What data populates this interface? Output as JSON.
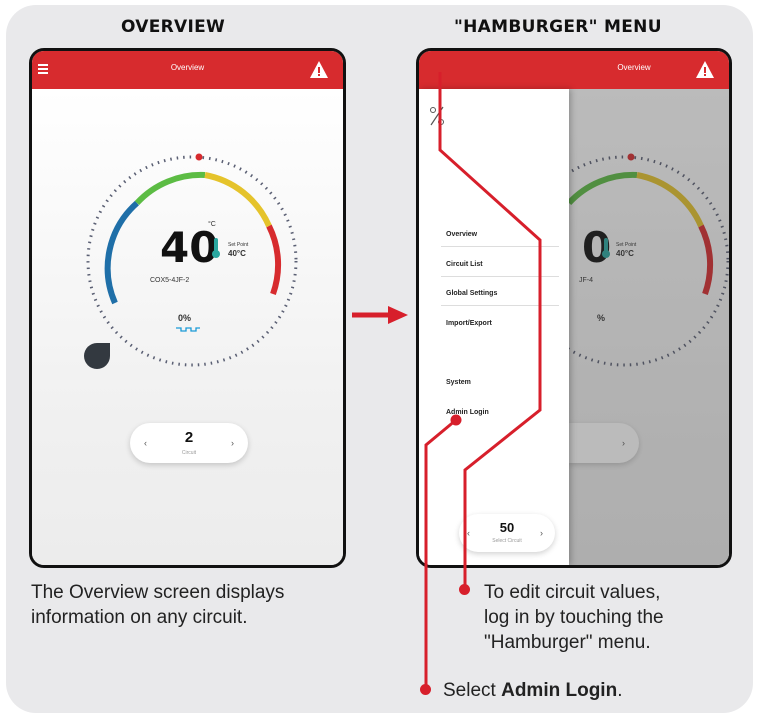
{
  "headings": {
    "overview": "OVERVIEW",
    "menu": "\"HAMBURGER\" MENU"
  },
  "overview_screen": {
    "title": "Overview",
    "temperature": "40",
    "temperature_unit": "°C",
    "set_point_label": "Set Point",
    "set_point_value": "40°C",
    "circuit_name": "COX5-4JF-2",
    "output_percent": "0%",
    "selector_value": "2",
    "selector_label": "Circuit"
  },
  "menu_screen": {
    "title": "Overview",
    "background_temperature": "0",
    "background_set_point_label": "Set Point",
    "background_set_point_value": "40°C",
    "background_circuit_fragment": "JF-4",
    "background_percent_fragment": "%",
    "menu_items": [
      "Overview",
      "Circuit List",
      "Global Settings",
      "Import/Export"
    ],
    "secondary_items": [
      "System",
      "Admin Login"
    ],
    "selector_value": "50",
    "selector_label": "Select Circuit"
  },
  "captions": {
    "overview_line1": "The Overview screen displays",
    "overview_line2": "information on any circuit.",
    "menu_line1": "To edit circuit values,",
    "menu_line2": "log in by touching the",
    "menu_line3": "\"Hamburger\" menu.",
    "select_prefix": "Select ",
    "select_bold": "Admin Login",
    "select_suffix": "."
  },
  "colors": {
    "accent_red": "#d72b2e",
    "callout_red": "#d71f2b",
    "panel_bg": "#e9e9eb"
  }
}
